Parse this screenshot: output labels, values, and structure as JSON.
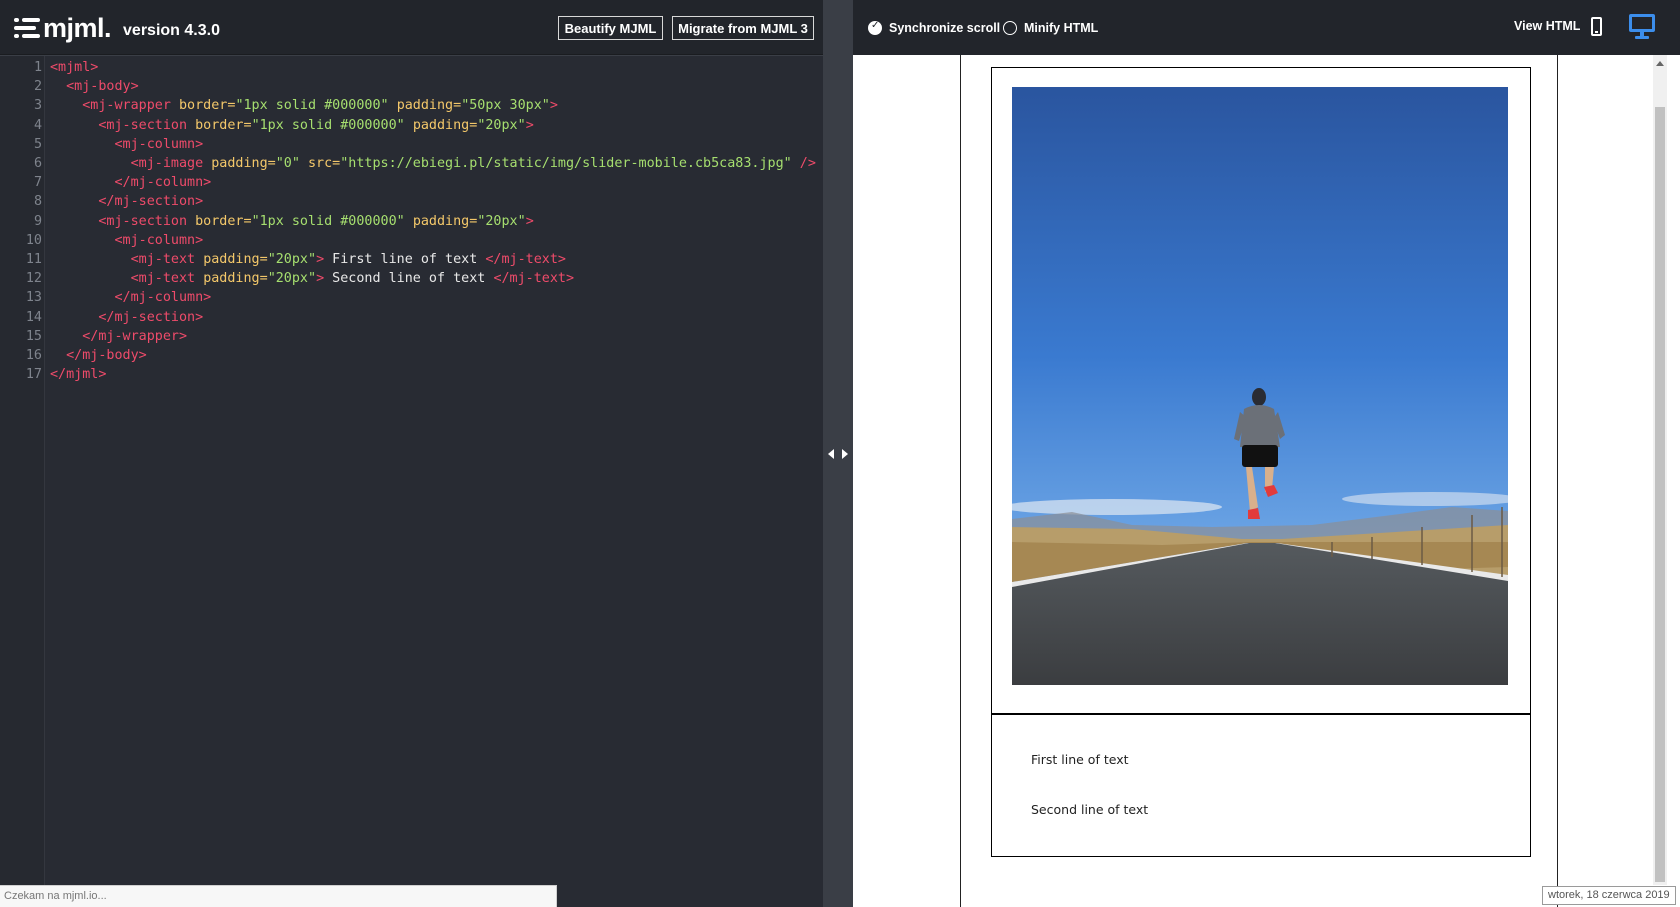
{
  "header": {
    "logo_text": "mjml.",
    "version": "version 4.3.0",
    "beautify_label": "Beautify MJML",
    "migrate_label": "Migrate from MJML 3"
  },
  "editor": {
    "lines": [
      {
        "n": "1",
        "tokens": [
          [
            "t",
            "<mjml>"
          ]
        ]
      },
      {
        "n": "2",
        "tokens": [
          [
            "p",
            "  "
          ],
          [
            "t",
            "<mj-body>"
          ]
        ]
      },
      {
        "n": "3",
        "tokens": [
          [
            "p",
            "    "
          ],
          [
            "t",
            "<mj-wrapper"
          ],
          [
            "p",
            " "
          ],
          [
            "a",
            "border="
          ],
          [
            "s",
            "\"1px solid #000000\""
          ],
          [
            "p",
            " "
          ],
          [
            "a",
            "padding="
          ],
          [
            "s",
            "\"50px 30px\""
          ],
          [
            "t",
            ">"
          ]
        ]
      },
      {
        "n": "4",
        "tokens": [
          [
            "p",
            "      "
          ],
          [
            "t",
            "<mj-section"
          ],
          [
            "p",
            " "
          ],
          [
            "a",
            "border="
          ],
          [
            "s",
            "\"1px solid #000000\""
          ],
          [
            "p",
            " "
          ],
          [
            "a",
            "padding="
          ],
          [
            "s",
            "\"20px\""
          ],
          [
            "t",
            ">"
          ]
        ]
      },
      {
        "n": "5",
        "tokens": [
          [
            "p",
            "        "
          ],
          [
            "t",
            "<mj-column>"
          ]
        ]
      },
      {
        "n": "6",
        "tokens": [
          [
            "p",
            "          "
          ],
          [
            "t",
            "<mj-image"
          ],
          [
            "p",
            " "
          ],
          [
            "a",
            "padding="
          ],
          [
            "s",
            "\"0\""
          ],
          [
            "p",
            " "
          ],
          [
            "a",
            "src="
          ],
          [
            "s",
            "\"https://ebiegi.pl/static/img/slider-mobile.cb5ca83.jpg\""
          ],
          [
            "p",
            " "
          ],
          [
            "t",
            "/>"
          ]
        ]
      },
      {
        "n": "7",
        "tokens": [
          [
            "p",
            "        "
          ],
          [
            "t",
            "</mj-column>"
          ]
        ]
      },
      {
        "n": "8",
        "tokens": [
          [
            "p",
            "      "
          ],
          [
            "t",
            "</mj-section>"
          ]
        ]
      },
      {
        "n": "9",
        "tokens": [
          [
            "p",
            "      "
          ],
          [
            "t",
            "<mj-section"
          ],
          [
            "p",
            " "
          ],
          [
            "a",
            "border="
          ],
          [
            "s",
            "\"1px solid #000000\""
          ],
          [
            "p",
            " "
          ],
          [
            "a",
            "padding="
          ],
          [
            "s",
            "\"20px\""
          ],
          [
            "t",
            ">"
          ]
        ]
      },
      {
        "n": "10",
        "tokens": [
          [
            "p",
            "        "
          ],
          [
            "t",
            "<mj-column>"
          ]
        ]
      },
      {
        "n": "11",
        "tokens": [
          [
            "p",
            "          "
          ],
          [
            "t",
            "<mj-text"
          ],
          [
            "p",
            " "
          ],
          [
            "a",
            "padding="
          ],
          [
            "s",
            "\"20px\""
          ],
          [
            "t",
            ">"
          ],
          [
            "p",
            " First line of text "
          ],
          [
            "t",
            "</mj-text>"
          ]
        ]
      },
      {
        "n": "12",
        "tokens": [
          [
            "p",
            "          "
          ],
          [
            "t",
            "<mj-text"
          ],
          [
            "p",
            " "
          ],
          [
            "a",
            "padding="
          ],
          [
            "s",
            "\"20px\""
          ],
          [
            "t",
            ">"
          ],
          [
            "p",
            " Second line of text "
          ],
          [
            "t",
            "</mj-text>"
          ]
        ]
      },
      {
        "n": "13",
        "tokens": [
          [
            "p",
            "        "
          ],
          [
            "t",
            "</mj-column>"
          ]
        ]
      },
      {
        "n": "14",
        "tokens": [
          [
            "p",
            "      "
          ],
          [
            "t",
            "</mj-section>"
          ]
        ]
      },
      {
        "n": "15",
        "tokens": [
          [
            "p",
            "    "
          ],
          [
            "t",
            "</mj-wrapper>"
          ]
        ]
      },
      {
        "n": "16",
        "tokens": [
          [
            "p",
            "  "
          ],
          [
            "t",
            "</mj-body>"
          ]
        ]
      },
      {
        "n": "17",
        "tokens": [
          [
            "t",
            "</mjml>"
          ]
        ]
      }
    ]
  },
  "status": {
    "text": "Czekam na mjml.io..."
  },
  "preview_toolbar": {
    "sync_scroll_label": "Synchronize scroll",
    "sync_scroll_checked": true,
    "minify_label": "Minify HTML",
    "minify_checked": false,
    "view_html_label": "View HTML",
    "mobile_icon": "mobile-icon",
    "desktop_icon": "desktop-icon",
    "active_view": "desktop"
  },
  "preview": {
    "text_line_1": "First line of text",
    "text_line_2": "Second line of text"
  },
  "tooltip": {
    "date": "wtorek, 18 czerwca 2019"
  },
  "colors": {
    "tag": "#ee4b6a",
    "attr": "#f4c86a",
    "string": "#a6df6f",
    "accent": "#3c8eec"
  }
}
